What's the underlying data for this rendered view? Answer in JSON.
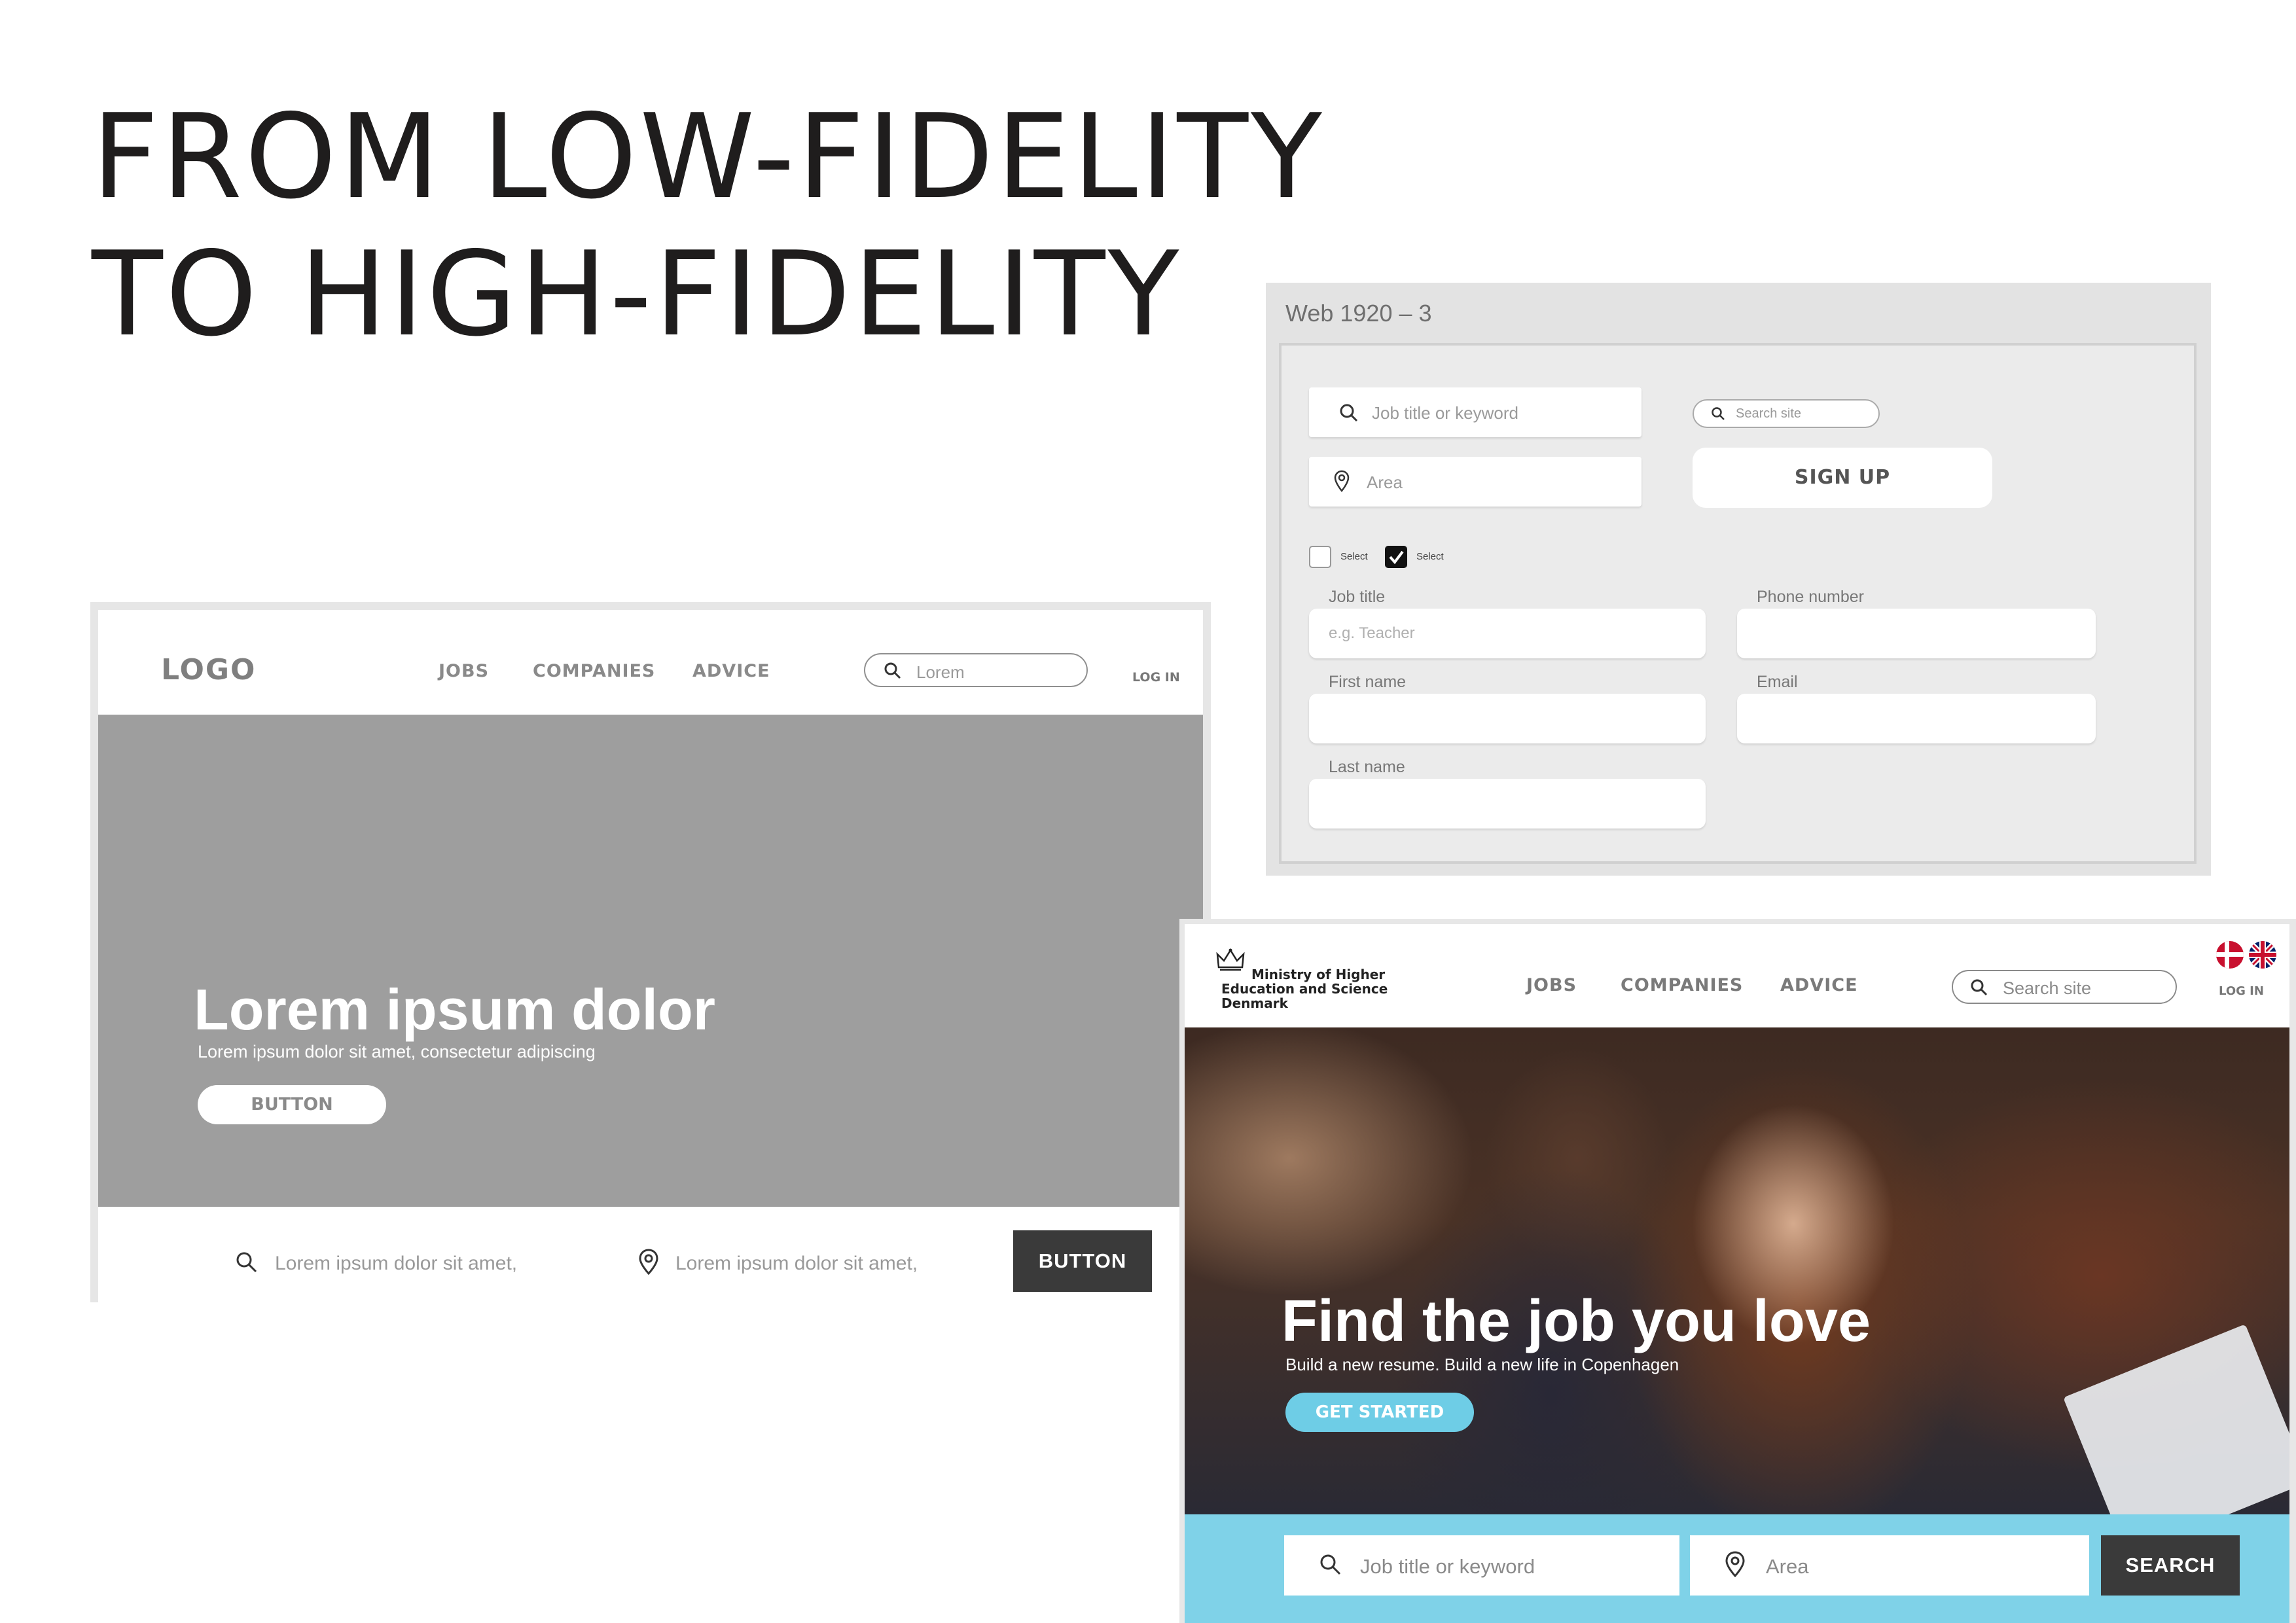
{
  "title": {
    "line1": "FROM LOW-FIDELITY",
    "line2": "TO HIGH-FIDELITY"
  },
  "lofi": {
    "logo": "LOGO",
    "nav": [
      "JOBS",
      "COMPANIES",
      "ADVICE"
    ],
    "search_placeholder": "Lorem",
    "login": "LOG IN",
    "hero_title": "Lorem ipsum dolor",
    "hero_subtitle": "Lorem ipsum dolor sit amet, consectetur adipiscing",
    "hero_button": "BUTTON",
    "bar_field1": "Lorem ipsum dolor sit amet,",
    "bar_field2": "Lorem ipsum dolor sit amet,",
    "bar_button": "BUTTON"
  },
  "form": {
    "frame_label": "Web 1920 – 3",
    "job_search_placeholder": "Job title or keyword",
    "area_placeholder": "Area",
    "site_search_placeholder": "Search site",
    "signup_label": "SIGN UP",
    "checkbox1": {
      "label": "Select",
      "checked": false
    },
    "checkbox2": {
      "label": "Select",
      "checked": true
    },
    "job_title_label": "Job title",
    "job_title_placeholder": "e.g. Teacher",
    "phone_label": "Phone number",
    "first_name_label": "First name",
    "email_label": "Email",
    "last_name_label": "Last name"
  },
  "hifi": {
    "ministry_line1": "Ministry of Higher",
    "ministry_line2": "Education and Science",
    "ministry_line3": "Denmark",
    "nav": [
      "JOBS",
      "COMPANIES",
      "ADVICE"
    ],
    "search_placeholder": "Search site",
    "login": "LOG IN",
    "hero_title": "Find the job you love",
    "hero_subtitle": "Build a new resume. Build a new life in Copenhagen",
    "hero_button": "GET STARTED",
    "job_placeholder": "Job title or keyword",
    "area_placeholder": "Area",
    "search_button": "SEARCH",
    "accent_color": "#7fd2e8"
  }
}
